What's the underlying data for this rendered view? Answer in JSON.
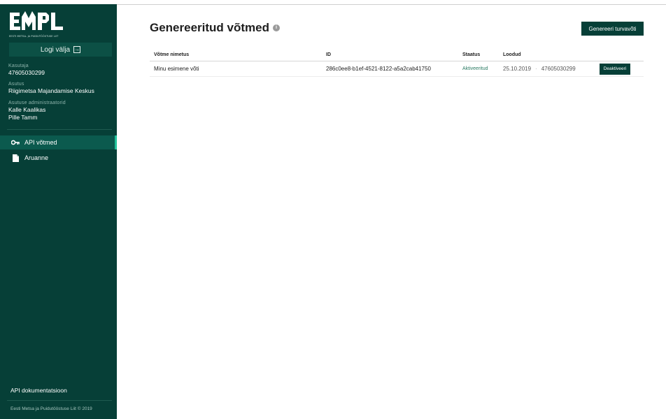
{
  "brand": {
    "logo_text": "EMPL",
    "logo_caption": "EESTI METSA- JA PUIDUTÖÖSTUSE LIIT"
  },
  "sidebar": {
    "logout_label": "Logi välja",
    "user_label": "Kasutaja",
    "user_value": "47605030299",
    "org_label": "Asutus",
    "org_value": "Riigimetsa Majandamise Keskus",
    "admins_label": "Asutuse administraatorid",
    "admins": [
      "Kalle Kaalikas",
      "Pille Tamm"
    ],
    "nav": [
      {
        "label": "API võtmed",
        "icon": "key-icon",
        "active": true
      },
      {
        "label": "Aruanne",
        "icon": "document-icon",
        "active": false
      }
    ],
    "docs_link": "API dokumentatsioon",
    "footer": "Eesti Metsa ja Puidutööstuse Liit © 2019"
  },
  "main": {
    "title": "Genereeritud võtmed",
    "title_icon": "info-icon",
    "generate_button": "Genereeri turvavõti",
    "table": {
      "headers": [
        "Võtme nimetus",
        "ID",
        "Staatus",
        "Loodud"
      ],
      "rows": [
        {
          "name": "Minu esimene võti",
          "id": "286c0ee8-b1ef-4521-8122-a5a2cab41750",
          "status": "Aktiveeritud",
          "created_date": "25.10.2019",
          "created_separator": "·",
          "created_by": "47605030299",
          "action": "Deaktiveeri"
        }
      ]
    }
  },
  "colors": {
    "sidebar_bg": "#063f37",
    "accent": "#20c29a",
    "button_bg": "#063f37"
  }
}
